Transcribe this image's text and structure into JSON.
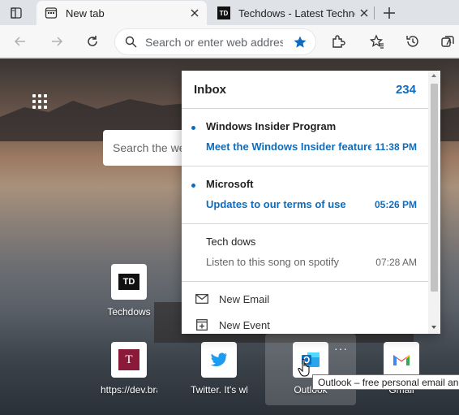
{
  "tabs": [
    {
      "title": "New tab",
      "active": true,
      "favicon": "newtab-icon"
    },
    {
      "title": "Techdows - Latest Technology News",
      "active": false,
      "favicon": "TD"
    }
  ],
  "toolbar": {
    "address_placeholder": "Search or enter web address",
    "icons": [
      "back-icon",
      "forward-icon",
      "refresh-icon",
      "search-icon",
      "favorite-star-icon",
      "extensions-icon",
      "favorites-icon",
      "history-icon",
      "collections-icon"
    ]
  },
  "newtab": {
    "search_placeholder": "Search the web",
    "tiles": [
      {
        "label": "Techdows",
        "icon": "TD"
      },
      {
        "label": "https://dev.bravehost.com",
        "icon": "T"
      },
      {
        "label": "Twitter. It's what's happening",
        "icon": "twitter-icon"
      },
      {
        "label": "Outlook",
        "icon": "outlook-icon"
      },
      {
        "label": "Gmail",
        "icon": "gmail-icon"
      }
    ],
    "more_label": "···"
  },
  "inbox": {
    "title": "Inbox",
    "count": "234",
    "messages": [
      {
        "sender": "Windows Insider Program",
        "subject": "Meet the Windows Insider feature",
        "time": "11:38 PM",
        "unread": true
      },
      {
        "sender": "Microsoft",
        "subject": "Updates to our terms of use",
        "time": "05:26 PM",
        "unread": true
      },
      {
        "sender": "Tech dows",
        "subject": "Listen to this song on spotify",
        "time": "07:28 AM",
        "unread": false
      }
    ],
    "actions": [
      {
        "label": "New Email",
        "icon": "mail-icon"
      },
      {
        "label": "New Event",
        "icon": "calendar-add-icon"
      }
    ]
  },
  "tooltip": "Outlook – free personal email and calendar",
  "colors": {
    "accent": "#0f6cbd",
    "tab_strip": "#dfe3e8",
    "toolbar": "#f7f7f7"
  }
}
